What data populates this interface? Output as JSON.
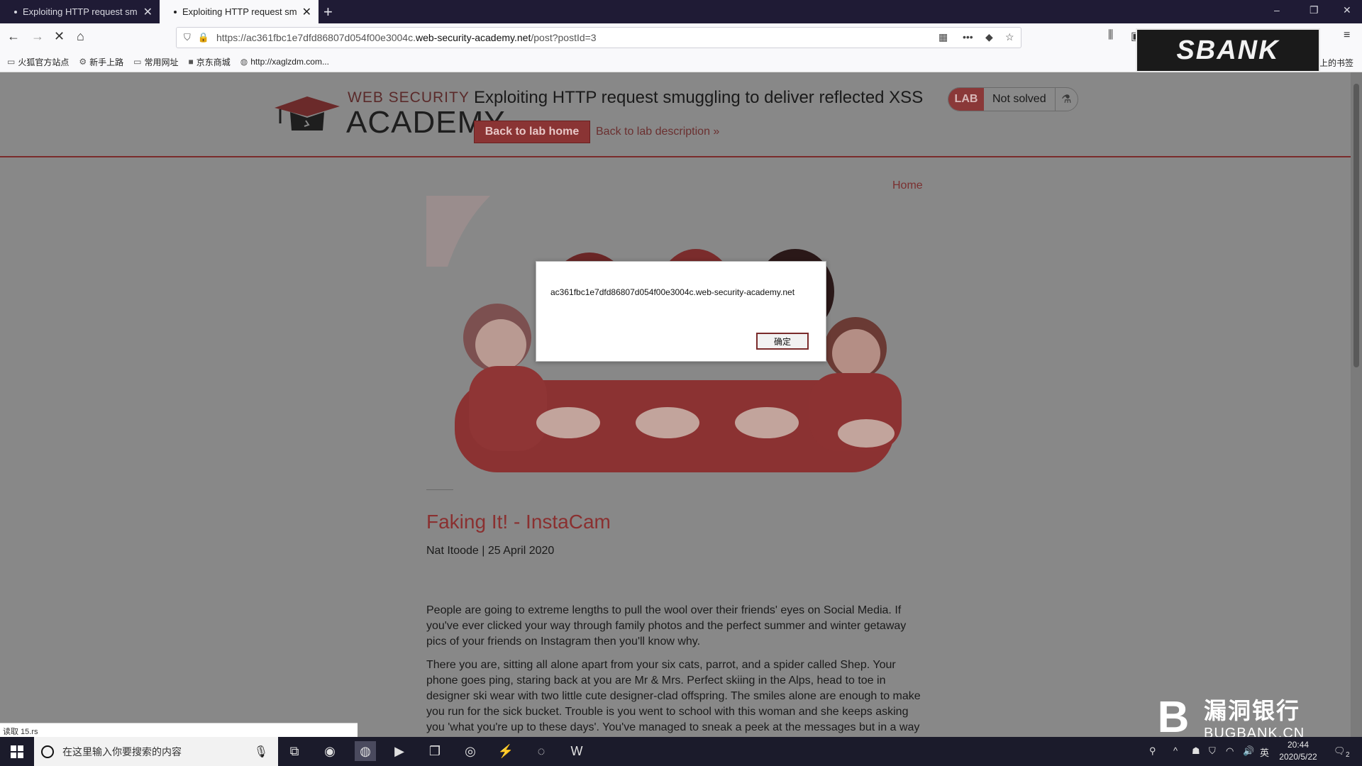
{
  "browser": {
    "tabs": [
      {
        "title": "Exploiting HTTP request sm"
      },
      {
        "title": "Exploiting HTTP request sm"
      }
    ],
    "new_tab": "+",
    "window_controls": {
      "minimize": "–",
      "restore": "❐",
      "close": "✕"
    },
    "url_prefix": "https://ac361fbc1e7dfd86807d054f00e3004c.",
    "url_host": "web-security-academy.net",
    "url_path": "/post?postId=3",
    "bookmarks": [
      "火狐官方站点",
      "新手上路",
      "常用网址",
      "京东商城",
      "http://xaglzdm.com..."
    ],
    "bookmarks_right": "移动设备上的书签",
    "status_text": "读取 15.rs"
  },
  "lab": {
    "logo_small": "WEB SECURITY",
    "logo_big": "ACADEMY",
    "title": "Exploiting HTTP request smuggling to deliver reflected XSS",
    "back_button": "Back to lab home",
    "description_link": "Back to lab description »",
    "badge_label": "LAB",
    "badge_status": "Not solved",
    "colors": {
      "accent": "#8a3434",
      "title_link": "#8a3030"
    }
  },
  "post": {
    "nav_home": "Home",
    "title": "Faking It! - InstaCam",
    "meta": "Nat Itoode | 25 April 2020",
    "paragraph1": "People are going to extreme lengths to pull the wool over their friends' eyes on Social Media. If you've ever clicked your way through family photos and the perfect summer and winter getaway pics of your friends on Instagram then you'll know why.",
    "paragraph2": "There you are, sitting all alone apart from your six cats, parrot, and a spider called Shep. Your phone goes ping, staring back at you are Mr & Mrs. Perfect skiing in the Alps, head to toe in designer ski wear with two little cute designer-clad offspring. The smiles alone are enough to make you run for the sick bucket. Trouble is you went to school with this woman and she keeps asking you 'what you're up to these days'. You've managed to sneak a peek at the messages but in a way"
  },
  "alert": {
    "message": "ac361fbc1e7dfd86807d054f00e3004c.web-security-academy.net",
    "ok_label": "确定"
  },
  "watermarks": {
    "top": "SBANK",
    "bottom_cn": "漏洞银行",
    "bottom_en": "BUGBANK.CN"
  },
  "taskbar": {
    "search_placeholder": "在这里输入你要搜索的内容",
    "input_method": "英",
    "time": "20:44",
    "date": "2020/5/22",
    "notification_count": "2"
  }
}
